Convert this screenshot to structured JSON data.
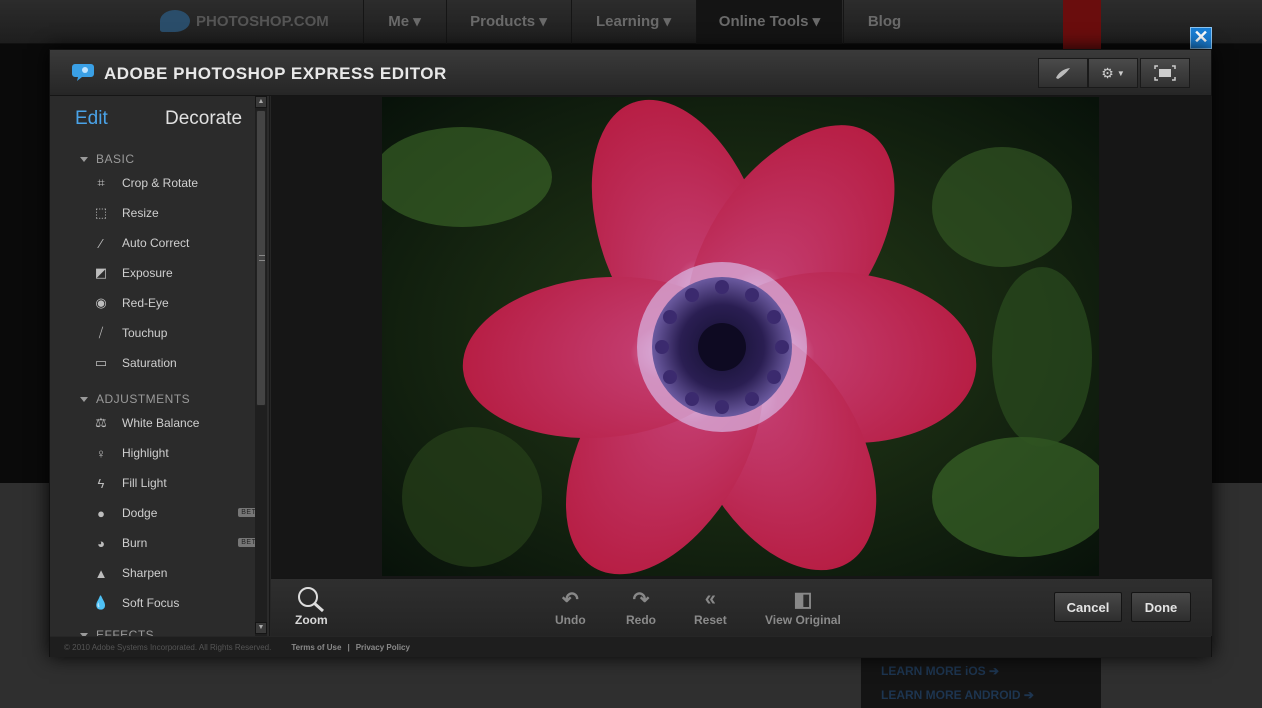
{
  "site": {
    "logo": "PHOTOSHOP.COM",
    "nav": [
      "Me ▾",
      "Products ▾",
      "Learning ▾",
      "Online Tools ▾",
      "Blog"
    ],
    "promo_links": [
      "LEARN MORE iOS ➔",
      "LEARN MORE ANDROID ➔"
    ]
  },
  "editor": {
    "title": "ADOBE PHOTOSHOP EXPRESS EDITOR",
    "header_buttons": [
      "brush-icon",
      "gear-icon",
      "fullscreen-icon"
    ],
    "close_label": "✕"
  },
  "sidebar": {
    "tabs": {
      "edit": "Edit",
      "decorate": "Decorate"
    },
    "sections": {
      "basic": "BASIC",
      "adjustments": "ADJUSTMENTS",
      "effects": "EFFECTS"
    },
    "basic_tools": [
      "Crop & Rotate",
      "Resize",
      "Auto Correct",
      "Exposure",
      "Red-Eye",
      "Touchup",
      "Saturation"
    ],
    "adjustment_tools": [
      "White Balance",
      "Highlight",
      "Fill Light",
      "Dodge",
      "Burn",
      "Sharpen",
      "Soft Focus"
    ],
    "beta_label": "BETA"
  },
  "toolbar": {
    "zoom": "Zoom",
    "undo": "Undo",
    "redo": "Redo",
    "reset": "Reset",
    "view_original": "View Original",
    "cancel": "Cancel",
    "done": "Done"
  },
  "footer": {
    "copyright": "© 2010 Adobe Systems Incorporated. All Rights Reserved.",
    "terms": "Terms of Use",
    "separator": "|",
    "privacy": "Privacy Policy"
  },
  "colors": {
    "accent": "#4aa3e8",
    "close": "#1a7fd6",
    "flower": "#c8284e"
  }
}
